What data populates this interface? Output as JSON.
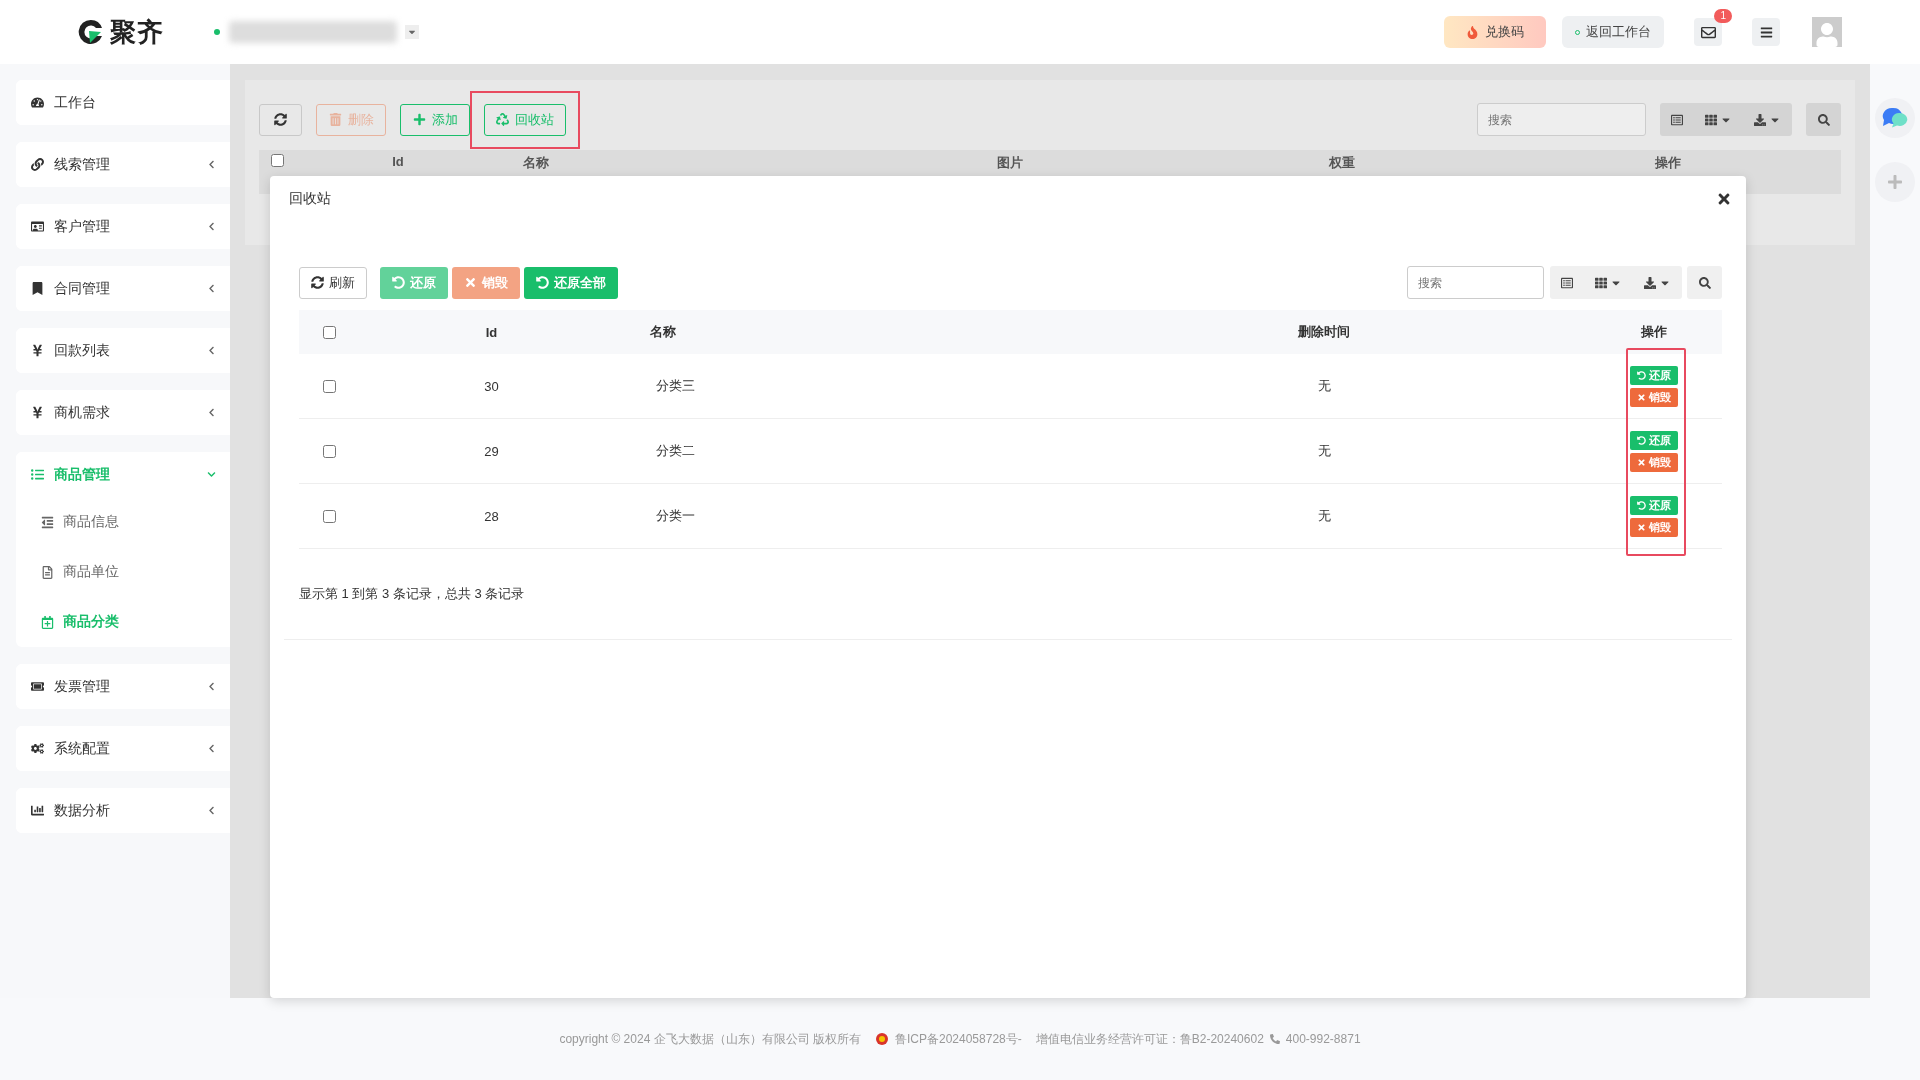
{
  "brand": {
    "name": "聚齐"
  },
  "topbar": {
    "redeem_button": "兑换码",
    "back_button": "返回工作台",
    "mail_badge": "1"
  },
  "sidebar": {
    "items": [
      {
        "kind": "link",
        "label": "工作台"
      },
      {
        "kind": "group",
        "label": "线索管理",
        "expanded": false
      },
      {
        "kind": "group",
        "label": "客户管理",
        "expanded": false
      },
      {
        "kind": "group",
        "label": "合同管理",
        "expanded": false
      },
      {
        "kind": "group",
        "label": "回款列表",
        "expanded": false
      },
      {
        "kind": "group",
        "label": "商机需求",
        "expanded": false
      },
      {
        "kind": "group",
        "label": "商品管理",
        "expanded": true,
        "children": [
          {
            "label": "商品信息",
            "selected": false
          },
          {
            "label": "商品单位",
            "selected": false
          },
          {
            "label": "商品分类",
            "selected": true
          }
        ]
      },
      {
        "kind": "group",
        "label": "发票管理",
        "expanded": false
      },
      {
        "kind": "group",
        "label": "系统配置",
        "expanded": false
      },
      {
        "kind": "group",
        "label": "数据分析",
        "expanded": false
      }
    ]
  },
  "page": {
    "toolbar": [
      {
        "kind": "refresh",
        "disabled": false
      },
      {
        "kind": "delete",
        "label": "删除",
        "disabled": true
      },
      {
        "kind": "add",
        "label": "添加",
        "disabled": false
      },
      {
        "kind": "recycle",
        "label": "回收站",
        "disabled": false,
        "highlighted": true
      }
    ],
    "search": {
      "placeholder": "搜索"
    },
    "all_selected": false,
    "columns": [
      "Id",
      "名称",
      "图片",
      "权重",
      "操作"
    ]
  },
  "modal": {
    "title": "回收站",
    "toolbar": [
      {
        "kind": "refresh",
        "label": "刷新"
      },
      {
        "kind": "restore",
        "label": "还原",
        "disabled": true
      },
      {
        "kind": "destroy",
        "label": "销毁",
        "disabled": true
      },
      {
        "kind": "restore",
        "label": "还原全部",
        "disabled": false
      }
    ],
    "search": {
      "placeholder": "搜索"
    },
    "all_selected": false,
    "columns": [
      "Id",
      "名称",
      "删除时间",
      "操作"
    ],
    "rows": [
      {
        "selected": false,
        "id": "30",
        "name": "分类三",
        "deleted_time": "无",
        "actions": [
          {
            "kind": "restore",
            "label": "还原"
          },
          {
            "kind": "destroy",
            "label": "销毁"
          }
        ]
      },
      {
        "selected": false,
        "id": "29",
        "name": "分类二",
        "deleted_time": "无",
        "actions": [
          {
            "kind": "restore",
            "label": "还原"
          },
          {
            "kind": "destroy",
            "label": "销毁"
          }
        ]
      },
      {
        "selected": false,
        "id": "28",
        "name": "分类一",
        "deleted_time": "无",
        "actions": [
          {
            "kind": "restore",
            "label": "还原"
          },
          {
            "kind": "destroy",
            "label": "销毁"
          }
        ]
      }
    ],
    "actions_highlighted": true,
    "summary": "显示第 1 到第 3 条记录，总共 3 条记录"
  },
  "footer": {
    "copyright": "copyright © 2024 企飞大数据（山东）有限公司 版权所有",
    "icp": "鲁ICP备2024058728号-",
    "license": "增值电信业务经营许可证：鲁B2-20240602",
    "phone": "400-992-8871"
  }
}
